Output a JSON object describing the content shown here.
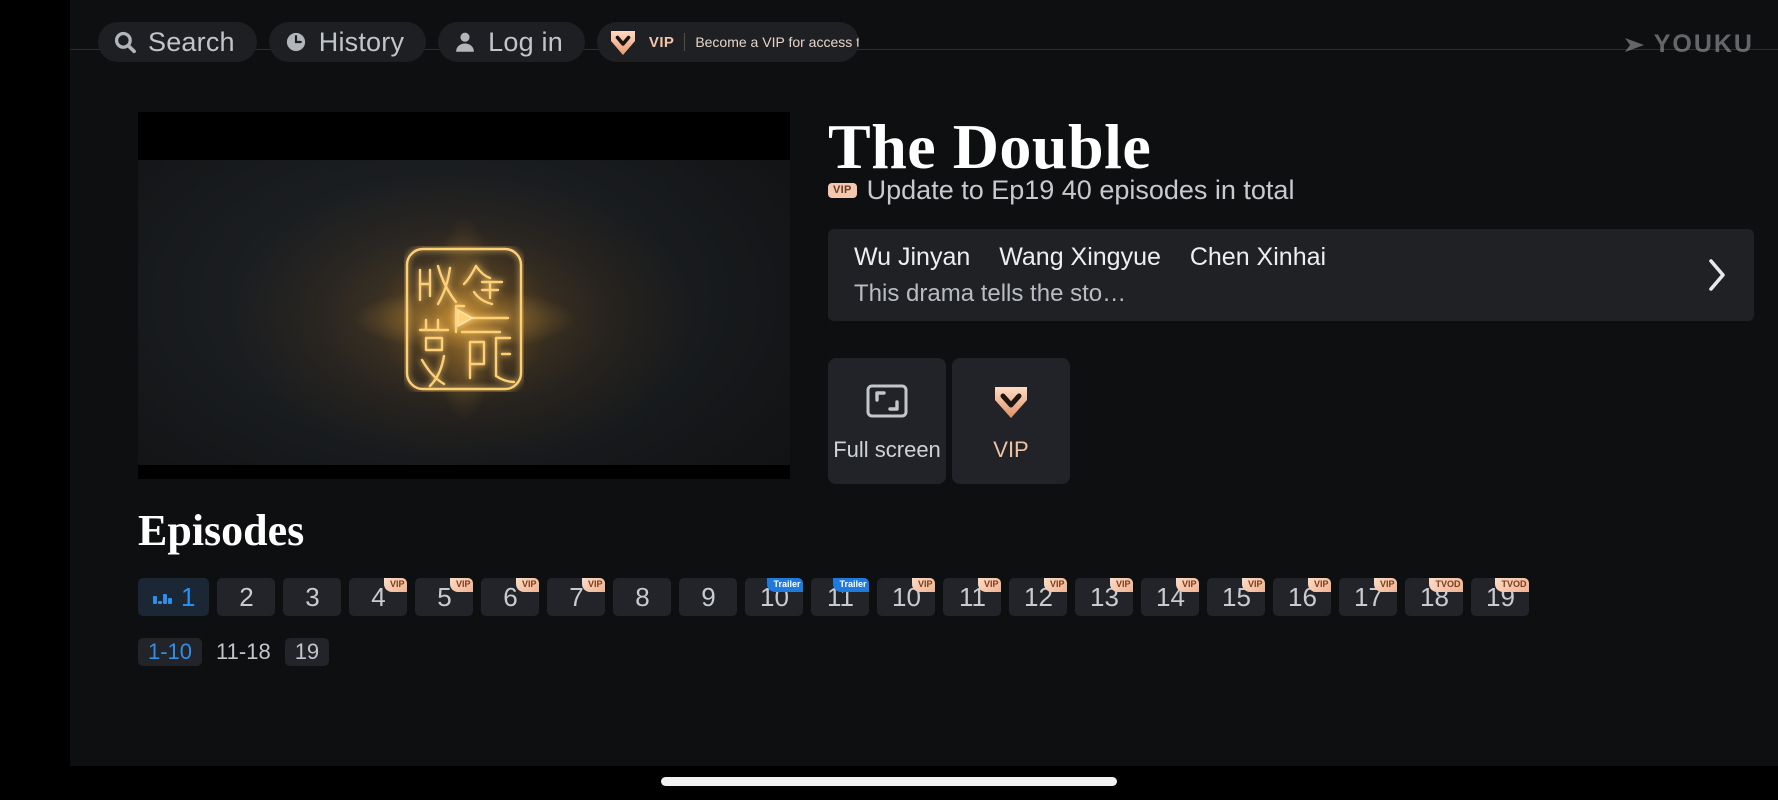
{
  "nav": {
    "items": [
      {
        "label": "Search",
        "icon": "search-icon"
      },
      {
        "label": "History",
        "icon": "history-clock-icon"
      },
      {
        "label": "Log in",
        "icon": "user-account-icon"
      }
    ],
    "vip_banner": {
      "icon": "vip-diamond-icon",
      "tag": "VIP",
      "message": "Become a VIP for access to exclusive"
    },
    "brand": {
      "icon": "youku-play-arrow-icon",
      "text": "YOUKU"
    }
  },
  "player": {
    "logo_icon": "china-net-av-play-logo",
    "play_icon": "play-triangle-icon"
  },
  "detail": {
    "title": "The Double",
    "vip_badge": "VIP",
    "update_status": "Update to Ep19 40 episodes in total",
    "cast": [
      "Wu Jinyan",
      "Wang Xingyue",
      "Chen Xinhai"
    ],
    "description": "This drama tells the sto…",
    "expand_icon": "chevron-right-icon"
  },
  "actions": [
    {
      "label": "Full screen",
      "icon": "fullscreen-icon",
      "accent": false
    },
    {
      "label": "VIP",
      "icon": "vip-diamond-icon",
      "accent": true
    }
  ],
  "episodes": {
    "heading": "Episodes",
    "items": [
      {
        "num": "1",
        "badge": "",
        "active": true,
        "icon": "now-playing-bars-icon"
      },
      {
        "num": "2",
        "badge": "",
        "active": false
      },
      {
        "num": "3",
        "badge": "",
        "active": false
      },
      {
        "num": "4",
        "badge": "VIP",
        "active": false
      },
      {
        "num": "5",
        "badge": "VIP",
        "active": false
      },
      {
        "num": "6",
        "badge": "VIP",
        "active": false
      },
      {
        "num": "7",
        "badge": "VIP",
        "active": false
      },
      {
        "num": "8",
        "badge": "",
        "active": false
      },
      {
        "num": "9",
        "badge": "",
        "active": false
      },
      {
        "num": "10",
        "badge": "Trailer",
        "active": false
      },
      {
        "num": "11",
        "badge": "Trailer",
        "active": false
      },
      {
        "num": "10",
        "badge": "VIP",
        "active": false
      },
      {
        "num": "11",
        "badge": "VIP",
        "active": false
      },
      {
        "num": "12",
        "badge": "VIP",
        "active": false
      },
      {
        "num": "13",
        "badge": "VIP",
        "active": false
      },
      {
        "num": "14",
        "badge": "VIP",
        "active": false
      },
      {
        "num": "15",
        "badge": "VIP",
        "active": false
      },
      {
        "num": "16",
        "badge": "VIP",
        "active": false
      },
      {
        "num": "17",
        "badge": "VIP",
        "active": false
      },
      {
        "num": "18",
        "badge": "TVOD",
        "active": false
      },
      {
        "num": "19",
        "badge": "TVOD",
        "active": false
      }
    ],
    "pages": [
      {
        "label": "1-10",
        "active": true
      },
      {
        "label": "11-18",
        "active": false
      },
      {
        "label": "19",
        "active": false
      }
    ]
  },
  "colors": {
    "accent_blue": "#2f8fe8",
    "vip_gold": "#f0b291",
    "trailer_blue": "#1f7ae0",
    "surface": "#222429",
    "background": "#0e0f11"
  }
}
